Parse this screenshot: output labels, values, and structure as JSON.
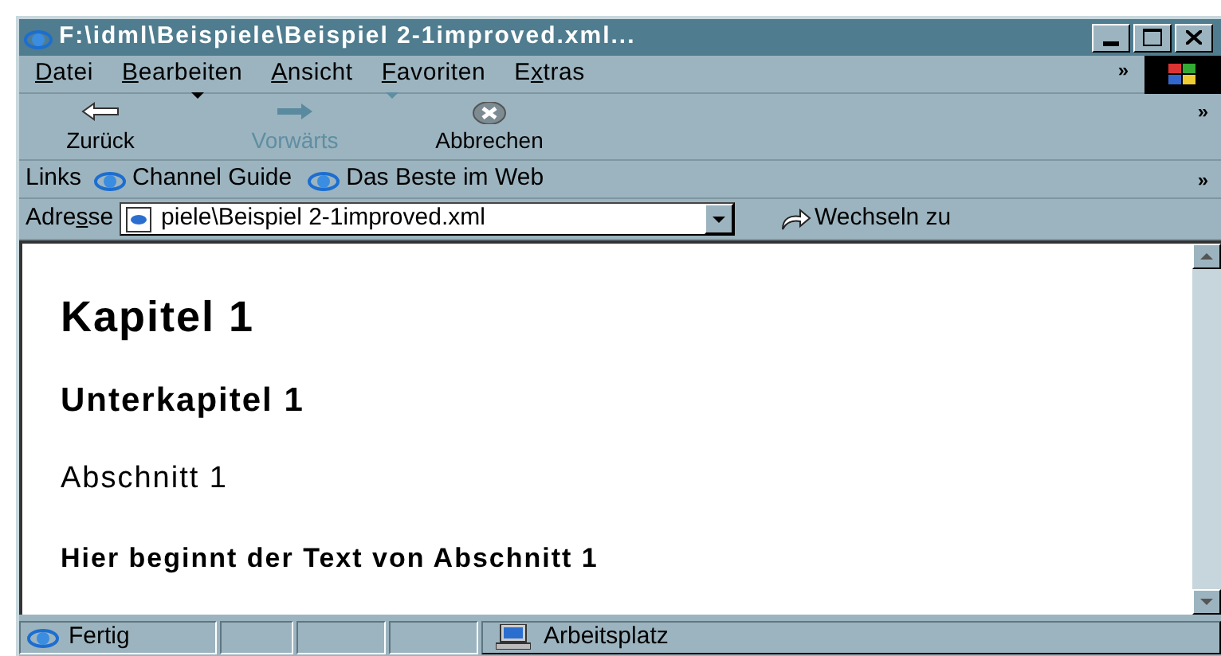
{
  "window": {
    "title": "F:\\idml\\Beispiele\\Beispiel 2-1improved.xml..."
  },
  "menu": [
    {
      "key": "D",
      "after": "atei"
    },
    {
      "key": "B",
      "after": "earbeiten"
    },
    {
      "key": "A",
      "after": "nsicht"
    },
    {
      "key": "F",
      "after": "avoriten"
    },
    {
      "before": "E",
      "key": "x",
      "after": "tras"
    }
  ],
  "menu_chevron": "»",
  "toolbar": [
    {
      "kind": "back",
      "label": "Zurück",
      "disabled": false,
      "dropdown": true
    },
    {
      "kind": "forward",
      "label": "Vorwärts",
      "disabled": true,
      "dropdown": true
    },
    {
      "kind": "stop",
      "label": "Abbrechen",
      "disabled": false,
      "dropdown": false
    }
  ],
  "toolbar_chevron": "»",
  "links": {
    "label": "Links",
    "items": [
      "Channel Guide",
      "Das Beste im Web"
    ],
    "chevron": "»"
  },
  "address": {
    "label_before": "Adre",
    "label_key": "s",
    "label_after": "se",
    "value": "piele\\Beispiel 2-1improved.xml",
    "go": "Wechseln zu"
  },
  "content": [
    {
      "kind": "h1",
      "text": "Kapitel 1"
    },
    {
      "kind": "h2",
      "text": "Unterkapitel 1"
    },
    {
      "kind": "h3",
      "text": "Abschnitt 1"
    },
    {
      "kind": "p",
      "text": "Hier beginnt der Text von Abschnitt 1"
    }
  ],
  "status_bar": {
    "status": "Fertig",
    "zone": "Arbeitsplatz"
  }
}
